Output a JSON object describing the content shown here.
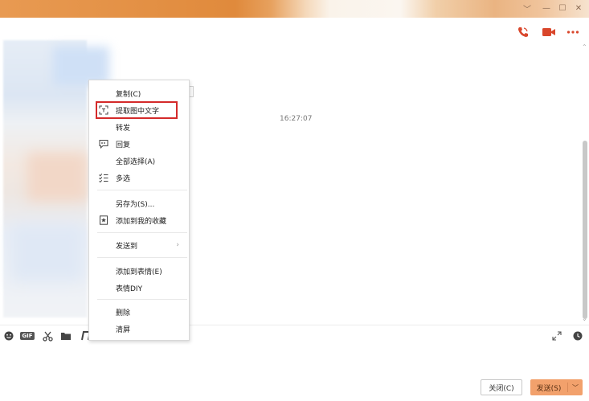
{
  "window": {
    "controls": {
      "dropdown": "﹀",
      "minimize": "—",
      "maximize": "☐",
      "close": "✕"
    }
  },
  "chat": {
    "timestamp": "16:27:07"
  },
  "context_menu": {
    "items": [
      {
        "id": "copy",
        "label": "复制(C)",
        "icon": ""
      },
      {
        "id": "extract-text",
        "label": "提取图中文字",
        "icon": "scan-text-icon"
      },
      {
        "id": "forward",
        "label": "转发",
        "icon": ""
      },
      {
        "id": "reply",
        "label": "回复",
        "icon": "reply-quote-icon"
      },
      {
        "id": "select-all",
        "label": "全部选择(A)",
        "icon": ""
      },
      {
        "id": "multi-select",
        "label": "多选",
        "icon": "checklist-icon"
      },
      {
        "id": "save-as",
        "label": "另存为(S)...",
        "icon": ""
      },
      {
        "id": "add-favorite",
        "label": "添加到我的收藏",
        "icon": "bookmark-icon"
      },
      {
        "id": "send-to",
        "label": "发送到",
        "icon": "",
        "submenu": "›"
      },
      {
        "id": "add-sticker",
        "label": "添加到表情(E)",
        "icon": ""
      },
      {
        "id": "sticker-diy",
        "label": "表情DIY",
        "icon": ""
      },
      {
        "id": "delete",
        "label": "删除",
        "icon": ""
      },
      {
        "id": "clear-screen",
        "label": "清屏",
        "icon": ""
      }
    ]
  },
  "toolbar": {
    "gif_label": "GIF"
  },
  "footer": {
    "close_label": "关闭(C)",
    "send_label": "发送(S)",
    "send_arrow": "﹀"
  },
  "colors": {
    "accent_orange": "#e08a3c",
    "send_button": "#f2a16c",
    "header_icon_red": "#d9462b",
    "highlight_red": "#d42a2a"
  }
}
